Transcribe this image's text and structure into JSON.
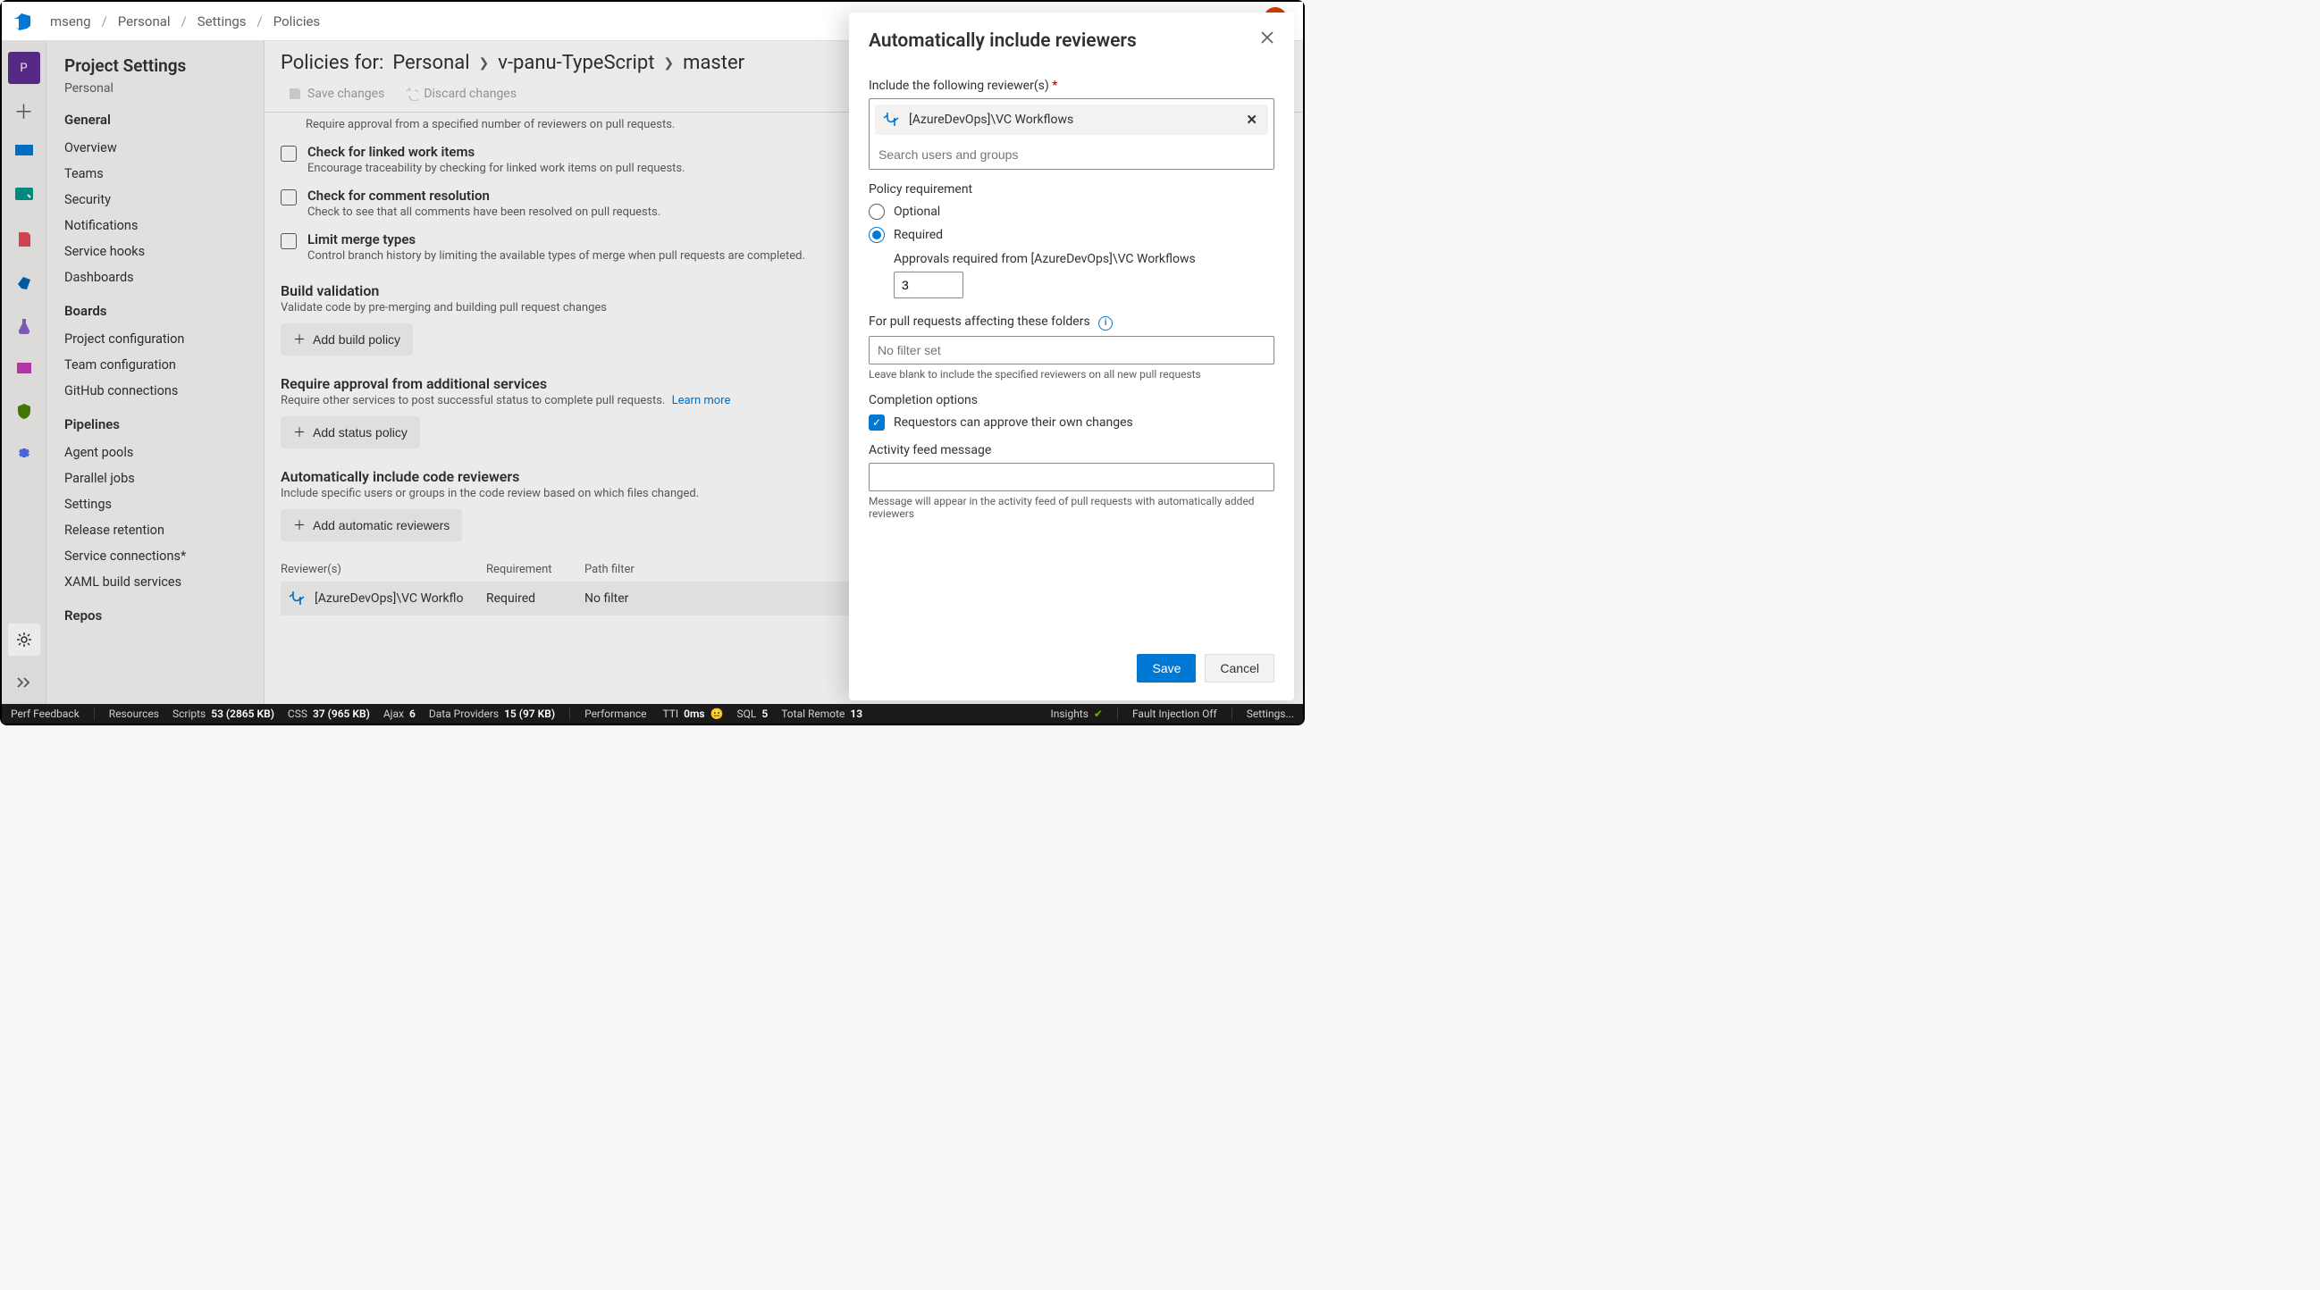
{
  "breadcrumbs": {
    "org": "mseng",
    "project": "Personal",
    "section": "Settings",
    "page": "Policies"
  },
  "sidebar": {
    "title": "Project Settings",
    "project": "Personal",
    "groups": [
      {
        "label": "General",
        "items": [
          "Overview",
          "Teams",
          "Security",
          "Notifications",
          "Service hooks",
          "Dashboards"
        ]
      },
      {
        "label": "Boards",
        "items": [
          "Project configuration",
          "Team configuration",
          "GitHub connections"
        ]
      },
      {
        "label": "Pipelines",
        "items": [
          "Agent pools",
          "Parallel jobs",
          "Settings",
          "Release retention",
          "Service connections*",
          "XAML build services"
        ]
      },
      {
        "label": "Repos",
        "items": []
      }
    ]
  },
  "main": {
    "policies_for_label": "Policies for:",
    "crumb_personal": "Personal",
    "crumb_repo": "v-panu-TypeScript",
    "crumb_branch": "master",
    "save_changes": "Save changes",
    "discard_changes": "Discard changes",
    "hint_require_approval": "Require approval from a specified number of reviewers on pull requests.",
    "policy_checks": [
      {
        "title": "Check for linked work items",
        "desc": "Encourage traceability by checking for linked work items on pull requests."
      },
      {
        "title": "Check for comment resolution",
        "desc": "Check to see that all comments have been resolved on pull requests."
      },
      {
        "title": "Limit merge types",
        "desc": "Control branch history by limiting the available types of merge when pull requests are completed."
      }
    ],
    "build_validation": {
      "title": "Build validation",
      "desc": "Validate code by pre-merging and building pull request changes",
      "add": "Add build policy"
    },
    "status_checks": {
      "title": "Require approval from additional services",
      "desc": "Require other services to post successful status to complete pull requests.",
      "learn_more": "Learn more",
      "add": "Add status policy"
    },
    "auto_reviewers": {
      "title": "Automatically include code reviewers",
      "desc": "Include specific users or groups in the code review based on which files changed.",
      "add": "Add automatic reviewers",
      "col_reviewers": "Reviewer(s)",
      "col_requirement": "Requirement",
      "col_path": "Path filter",
      "row_reviewer": "[AzureDevOps]\\VC Workflo",
      "row_requirement": "Required",
      "row_path": "No filter"
    }
  },
  "panel": {
    "title": "Automatically include reviewers",
    "include_label": "Include the following reviewer(s)",
    "chip_text": "[AzureDevOps]\\VC Workflows",
    "search_placeholder": "Search users and groups",
    "requirement_label": "Policy requirement",
    "optional": "Optional",
    "required": "Required",
    "approvals_label": "Approvals required from [AzureDevOps]\\VC Workflows",
    "approvals_value": "3",
    "folders_label": "For pull requests affecting these folders",
    "folders_placeholder": "No filter set",
    "folders_helper": "Leave blank to include the specified reviewers on all new pull requests",
    "completion_label": "Completion options",
    "requestors_own": "Requestors can approve their own changes",
    "activity_label": "Activity feed message",
    "activity_helper": "Message will appear in the activity feed of pull requests with automatically added reviewers",
    "save": "Save",
    "cancel": "Cancel"
  },
  "status": {
    "perf": "Perf Feedback",
    "resources": "Resources",
    "scripts_lbl": "Scripts",
    "scripts_val": "53 (2865 KB)",
    "css_lbl": "CSS",
    "css_val": "37 (965 KB)",
    "ajax_lbl": "Ajax",
    "ajax_val": "6",
    "dp_lbl": "Data Providers",
    "dp_val": "15 (97 KB)",
    "performance": "Performance",
    "tti_lbl": "TTI",
    "tti_val": "0ms",
    "sql_lbl": "SQL",
    "sql_val": "5",
    "tr_lbl": "Total Remote",
    "tr_val": "13",
    "insights": "Insights",
    "fault": "Fault Injection Off",
    "settings": "Settings..."
  },
  "colors": {
    "primary": "#0078d4",
    "danger": "#d83b01"
  },
  "nav_icons": [
    {
      "name": "project-tile",
      "bg": "#5c2e91"
    },
    {
      "name": "dashboards-icon",
      "bg": "#0078d4"
    },
    {
      "name": "boards-icon",
      "bg": "#009688"
    },
    {
      "name": "repos-icon",
      "bg": "#e74856"
    },
    {
      "name": "pipelines-icon",
      "bg": "#0063b1"
    },
    {
      "name": "test-plans-icon",
      "bg": "#8661c5"
    },
    {
      "name": "artifacts-icon",
      "bg": "#c239b3"
    },
    {
      "name": "security-icon",
      "bg": "#498205"
    },
    {
      "name": "extensions-icon",
      "bg": "#4f6bed"
    }
  ]
}
